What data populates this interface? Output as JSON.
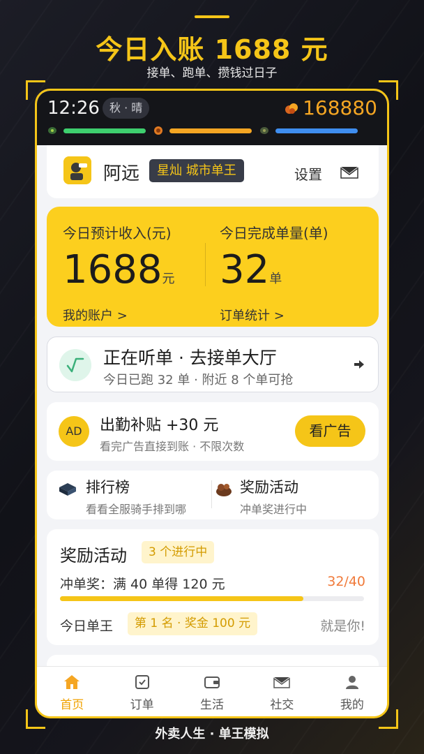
{
  "promo": {
    "headline": "今日入账 1688 元",
    "subheadline": "接单、跑单、攒钱过日子",
    "footer": "外卖人生 · 单王模拟"
  },
  "status_bar": {
    "time": "12:26",
    "weather": "秋 · 晴",
    "coins": "168880",
    "bars": [
      {
        "icon": "leaf-icon",
        "color": "#3ecf6e"
      },
      {
        "icon": "food-icon",
        "color": "#f5a623"
      },
      {
        "icon": "energy-icon",
        "color": "#3f8ef0"
      }
    ]
  },
  "profile": {
    "name": "阿远",
    "title": "星灿 城市单王",
    "settings_label": "设置"
  },
  "income": {
    "left": {
      "label": "今日预计收入(元)",
      "value": "1688",
      "unit": "元",
      "link": "我的账户 >"
    },
    "right": {
      "label": "今日完成单量(单)",
      "value": "32",
      "unit": "单",
      "link": "订单统计 >"
    }
  },
  "listening": {
    "title": "正在听单 · 去接单大厅",
    "subtitle": "今日已跑 32 单 · 附近 8 个单可抢"
  },
  "ad": {
    "badge": "AD",
    "title": "出勤补贴 +30 元",
    "subtitle": "看完广告直接到账 · 不限次数",
    "button": "看广告"
  },
  "shortcuts": [
    {
      "title": "排行榜",
      "subtitle": "看看全服骑手排到哪"
    },
    {
      "title": "奖励活动",
      "subtitle": "冲单奖进行中"
    }
  ],
  "rewards": {
    "title": "奖励活动",
    "badge": "3 个进行中",
    "task": "冲单奖：满 40 单得 120 元",
    "progress_text": "32/40",
    "progress": 0.8,
    "king_label": "今日单王",
    "rank": "第 1 名 · 奖金 100 元",
    "you": "就是你!"
  },
  "tabs": [
    {
      "label": "首页",
      "icon": "home-icon",
      "active": true
    },
    {
      "label": "订单",
      "icon": "order-check-icon",
      "active": false
    },
    {
      "label": "生活",
      "icon": "wallet-icon",
      "active": false
    },
    {
      "label": "社交",
      "icon": "mail-icon",
      "active": false
    },
    {
      "label": "我的",
      "icon": "user-icon",
      "active": false
    }
  ],
  "colors": {
    "accent": "#f5c518",
    "active_tab": "#f0a200",
    "progress_text": "#f07a3a"
  }
}
